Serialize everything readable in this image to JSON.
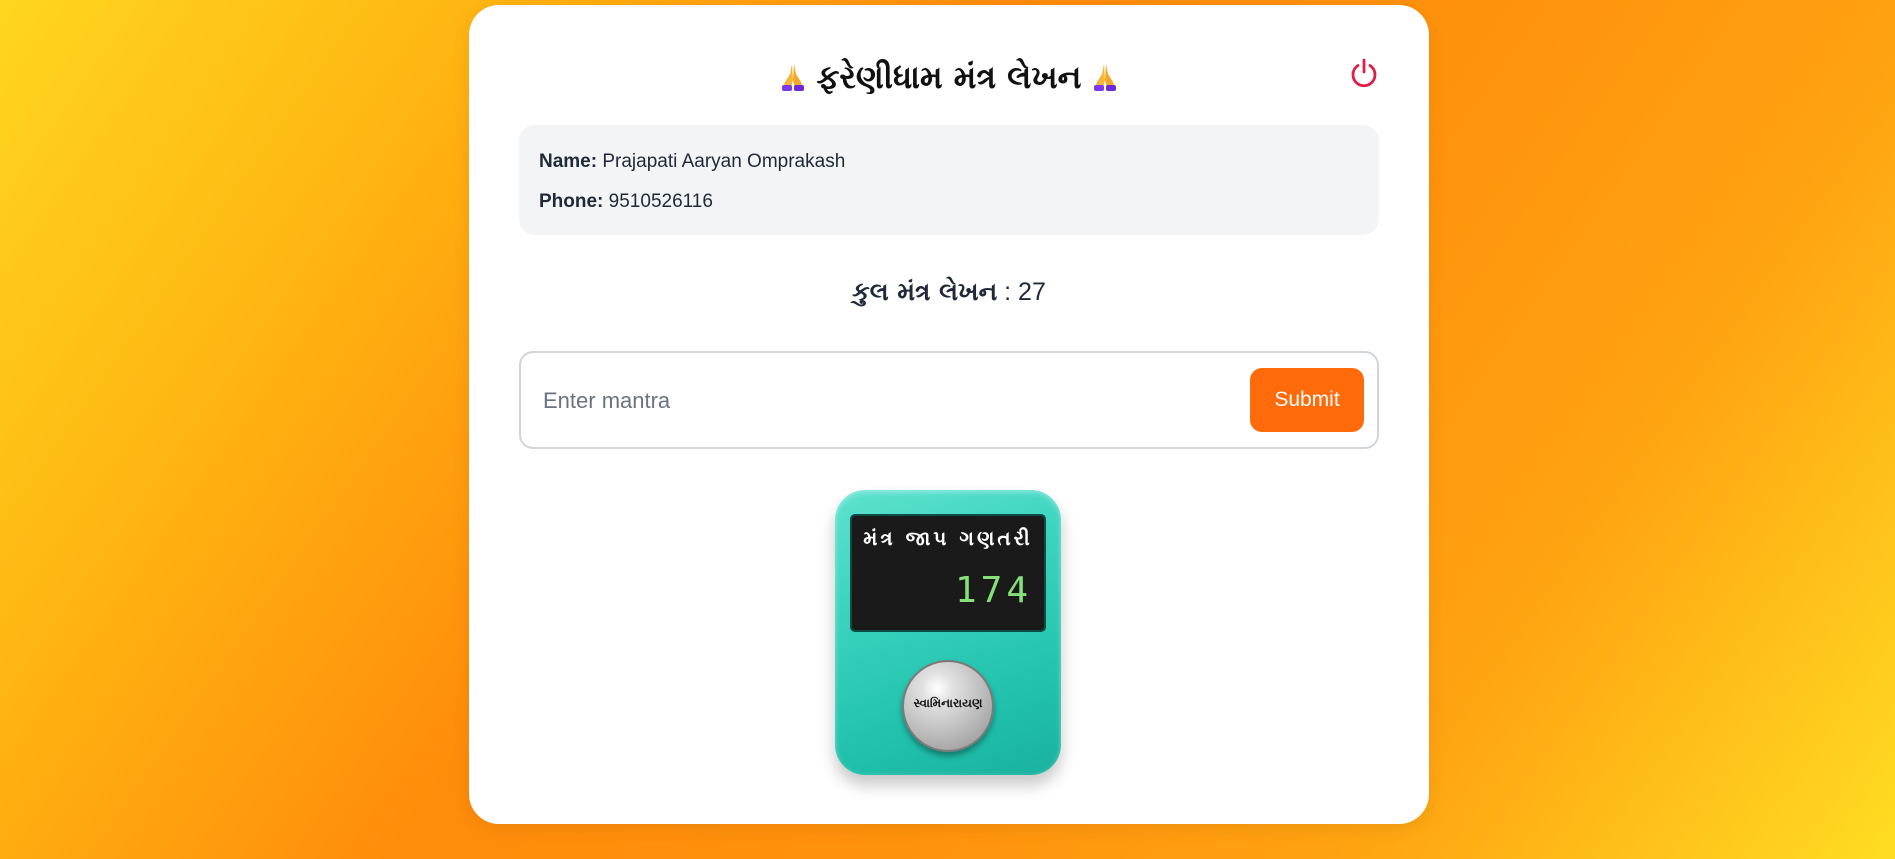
{
  "header": {
    "title": "ફરેણીધામ મંત્ર લેખન",
    "logout_icon": "power-icon",
    "title_icon": "praying-hands-icon"
  },
  "user": {
    "name_label": "Name:",
    "name_value": "Prajapati Aaryan Omprakash",
    "phone_label": "Phone:",
    "phone_value": "9510526116"
  },
  "total": {
    "label": "કુલ મંત્ર લેખન",
    "separator": " : ",
    "value": "27"
  },
  "entry": {
    "placeholder": "Enter mantra",
    "submit_label": "Submit"
  },
  "counter": {
    "label": "મંત્ર જાપ ગણતરી",
    "count": "174",
    "button_label": "સ્વામિનારાયણ"
  },
  "colors": {
    "accent": "#ff6b0a",
    "logout": "#e11d48",
    "counter_body": "#2ccab5",
    "counter_digits": "#86e07a"
  }
}
